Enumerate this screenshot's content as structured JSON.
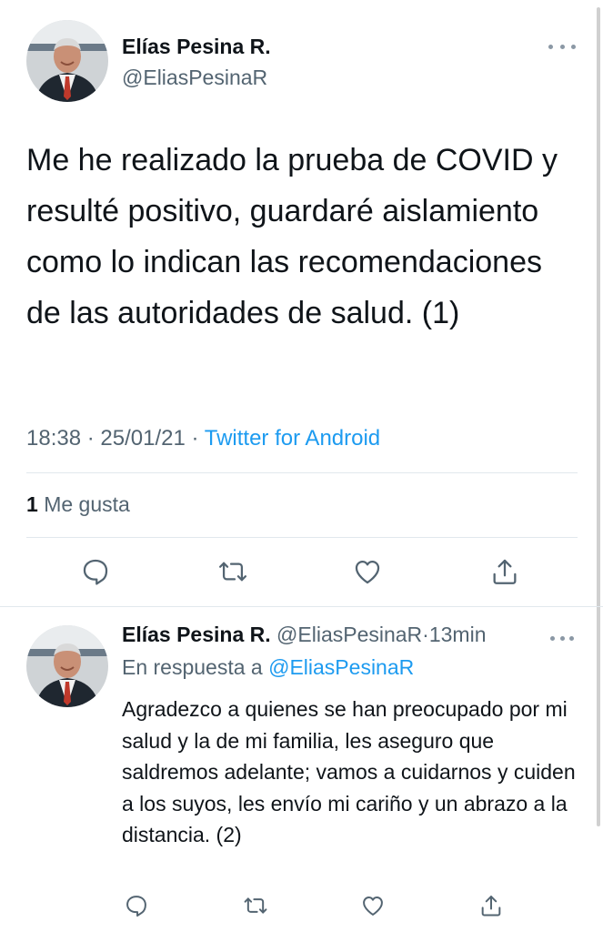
{
  "main_tweet": {
    "author_name": "Elías Pesina R.",
    "handle": "@EliasPesinaR",
    "text": "Me he realizado la prueba de COVID y resulté positivo, guardaré aislamiento como lo indican las recomendaciones de las autoridades de salud. (1)",
    "time": "18:38",
    "date": "25/01/21",
    "separator": "·",
    "source": "Twitter for Android",
    "likes_count": "1",
    "likes_label": "Me gusta"
  },
  "reply": {
    "author_name": "Elías Pesina R.",
    "handle": "@EliasPesinaR",
    "separator": "·",
    "time": "13min",
    "reply_to_label": "En respuesta a",
    "reply_to_handle": "@EliasPesinaR",
    "text": "Agradezco a quienes se han preocupado por mi salud y la de mi familia, les aseguro que saldremos adelante; vamos a cuidarnos y cuiden a los suyos, les envío mi cariño y un abrazo a la distancia. (2)"
  },
  "icons": {
    "more": "more-horizontal-icon",
    "reply": "reply-icon",
    "retweet": "retweet-icon",
    "like": "heart-icon",
    "share": "share-icon"
  },
  "colors": {
    "text": "#0f1419",
    "secondary": "#536471",
    "accent": "#1d9bf0",
    "divider": "#e1e8ed"
  }
}
